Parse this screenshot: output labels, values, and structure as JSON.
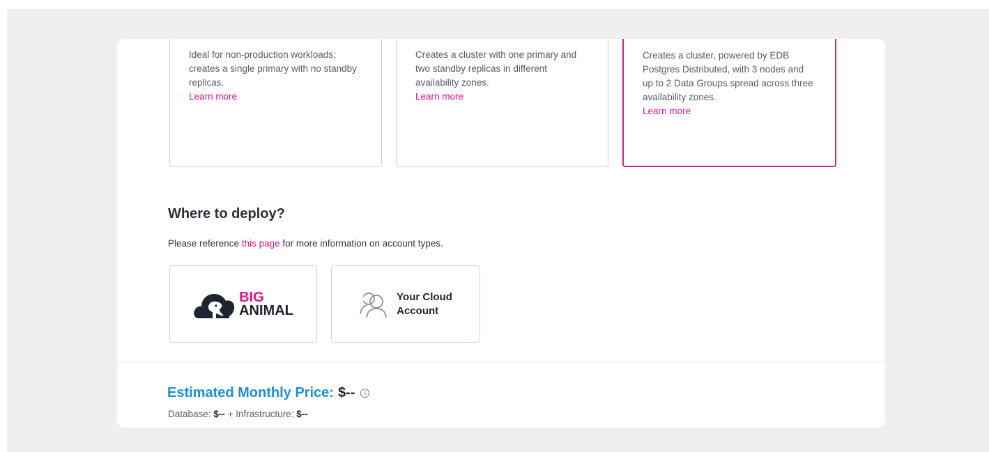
{
  "cluster_types": [
    {
      "description": "Ideal for non-production workloads; creates a single primary with no standby replicas.",
      "learn_more": "Learn more",
      "selected": false
    },
    {
      "description": "Creates a cluster with one primary and two standby replicas in different availability zones.",
      "learn_more": "Learn more",
      "selected": false
    },
    {
      "description": "Creates a cluster, powered by EDB Postgres Distributed, with 3 nodes and up to 2 Data Groups spread across three availability zones.",
      "learn_more": "Learn more",
      "selected": true
    }
  ],
  "deploy": {
    "title": "Where to deploy?",
    "reference_prefix": "Please reference",
    "reference_link": "this page",
    "reference_suffix": "for more information on account types.",
    "options": [
      {
        "brand_top": "BIG",
        "brand_bottom": "ANIMAL",
        "icon": "biganimal-logo-icon"
      },
      {
        "line1": "Your Cloud",
        "line2": "Account",
        "icon": "users-icon"
      }
    ]
  },
  "pricing": {
    "label": "Estimated Monthly Price:",
    "value": "$--",
    "info_icon": "info-icon",
    "database_label": "Database:",
    "database_value": "$--",
    "plus": "+",
    "infrastructure_label": "Infrastructure:",
    "infrastructure_value": "$--"
  },
  "colors": {
    "accent": "#e3148a",
    "price_label": "#1a8fd9",
    "dark": "#1f2430"
  }
}
